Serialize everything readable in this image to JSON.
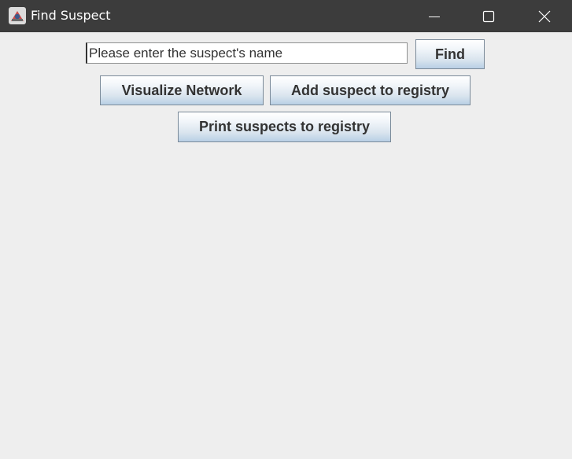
{
  "window": {
    "title": "Find Suspect",
    "controls": {
      "minimize": "minimize-icon",
      "maximize": "maximize-icon",
      "close": "close-icon"
    },
    "titlebar_color": "#3c3c3c"
  },
  "search": {
    "placeholder": "Please enter the suspect's name",
    "value": "Please enter the suspect's name",
    "find_label": "Find"
  },
  "actions": {
    "visualize_label": "Visualize Network",
    "add_label": "Add suspect to registry",
    "print_label": "Print suspects to registry"
  },
  "colors": {
    "background": "#eeeeee",
    "button_gradient_top": "#ffffff",
    "button_gradient_bottom": "#b8cfe5",
    "button_border": "#7a8a99",
    "text": "#333333"
  }
}
